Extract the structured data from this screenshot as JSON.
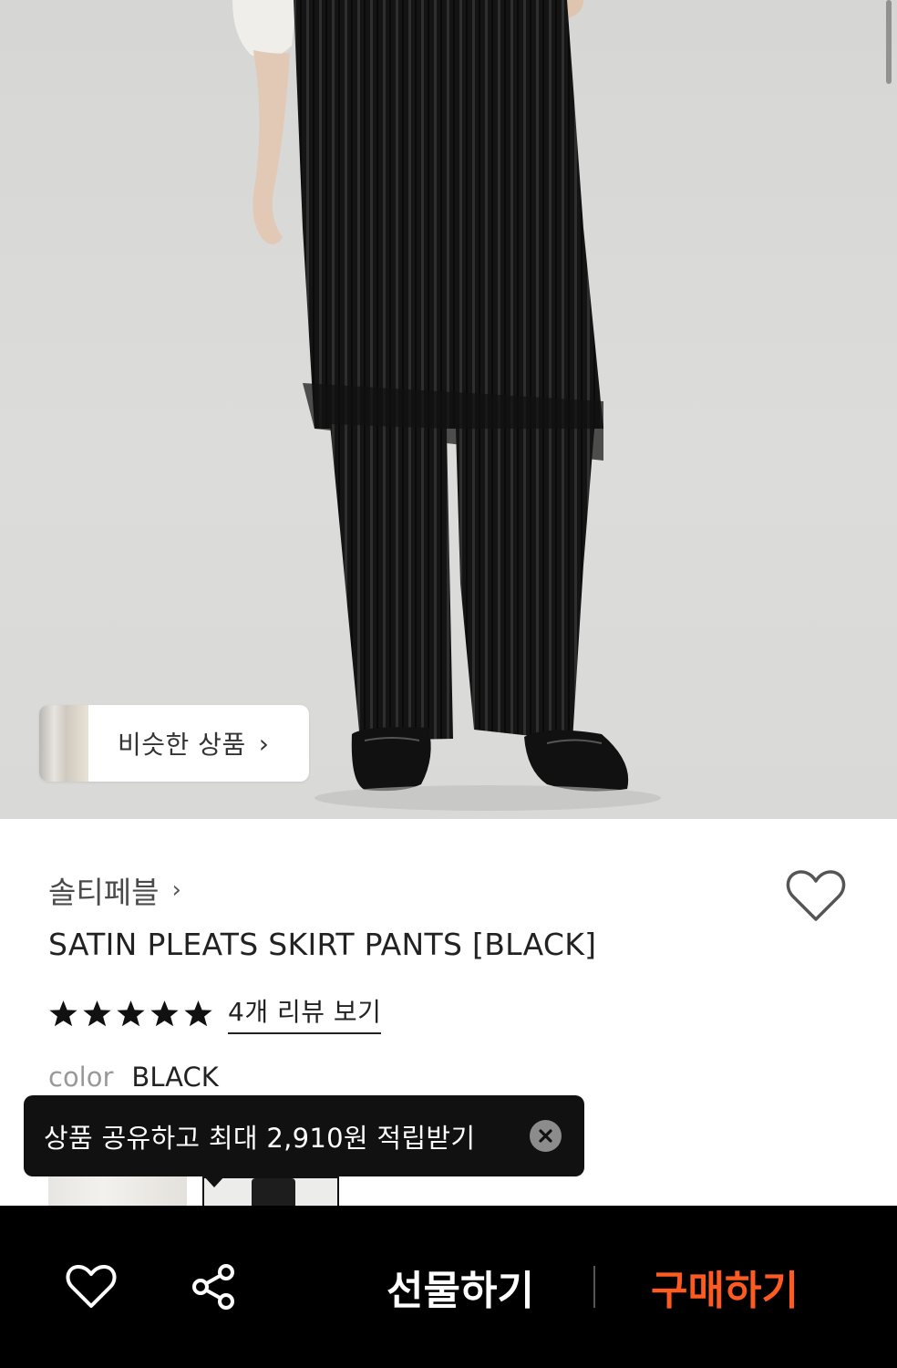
{
  "hero": {
    "image_desc_icon": "product-photo",
    "similar_products": {
      "label": "비슷한 상품",
      "chevron": "›"
    }
  },
  "product": {
    "brand": "솔티페블",
    "brand_chevron": "›",
    "title": "SATIN PLEATS SKIRT PANTS [BLACK]",
    "rating": 5,
    "rating_max": 5,
    "review_link": "4개 리뷰 보기",
    "color_label": "color",
    "color_value": "BLACK"
  },
  "tooltip": {
    "text": "상품 공유하고 최대 2,910원 적립받기"
  },
  "bottom_bar": {
    "gift_label": "선물하기",
    "buy_label": "구매하기"
  },
  "colors": {
    "accent": "#ff5a1f",
    "bar_background": "#000000",
    "tooltip_background": "#111111"
  }
}
